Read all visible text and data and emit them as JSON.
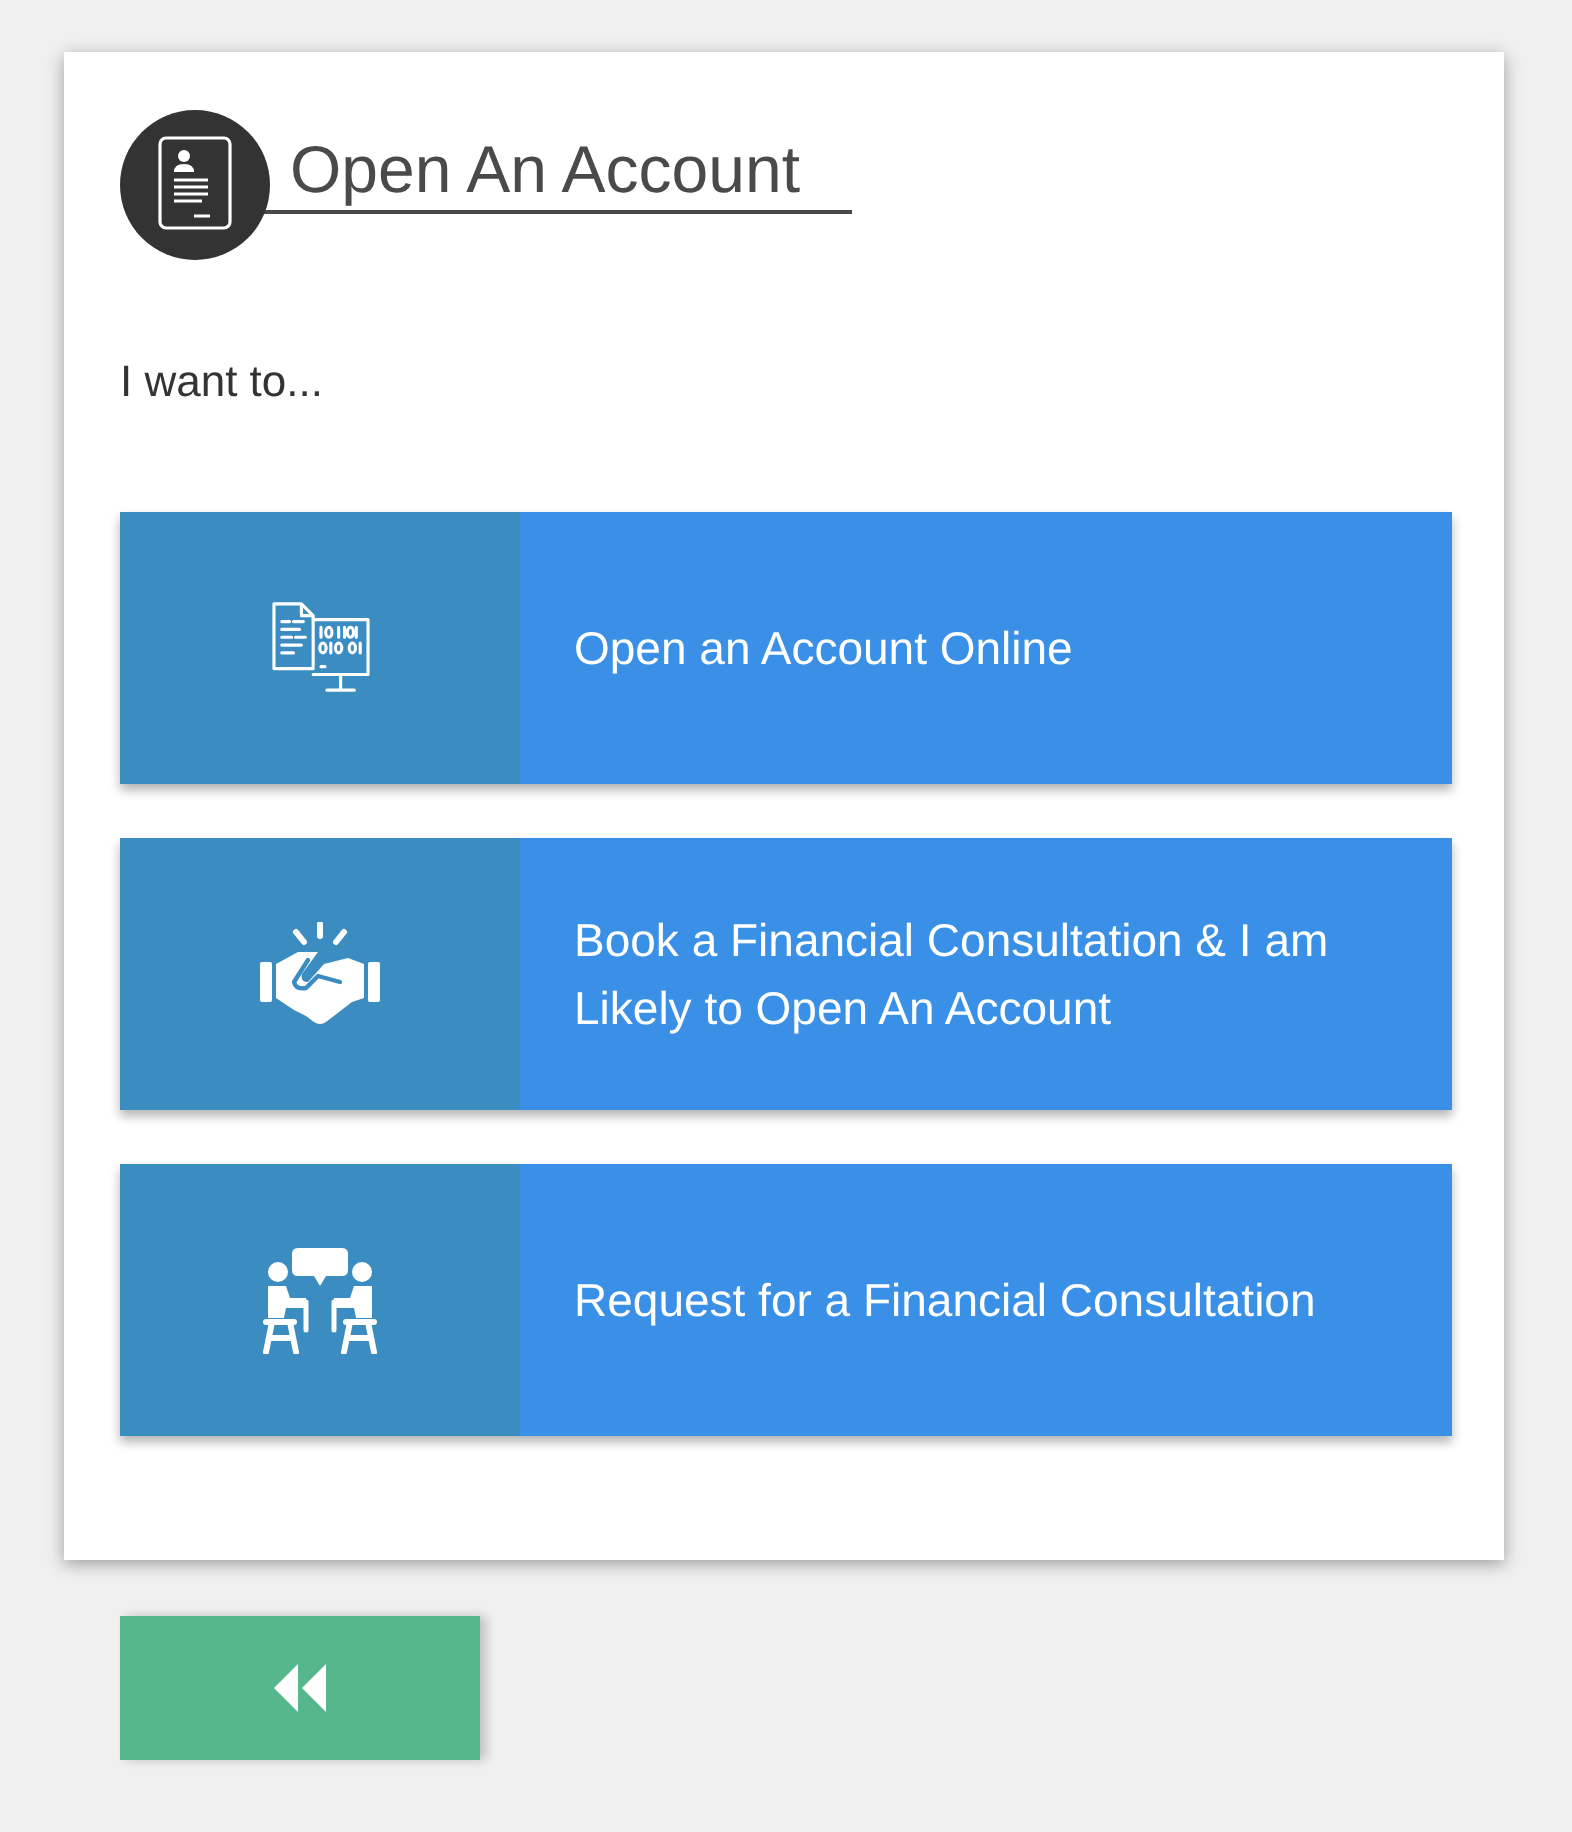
{
  "header": {
    "title": "Open An Account"
  },
  "prompt": "I want to...",
  "options": [
    {
      "label": "Open an Account Online"
    },
    {
      "label": "Book a Financial Consultation & I am Likely to Open An Account"
    },
    {
      "label": "Request for a Financial Consultation"
    }
  ]
}
